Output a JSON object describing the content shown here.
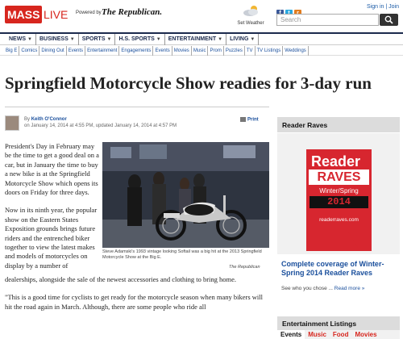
{
  "header": {
    "logo_primary": "MASS",
    "logo_secondary": "LIVE",
    "powered_by": "Powered by",
    "paper_name": "The Republican.",
    "weather_label": "Set Weather",
    "signin": "Sign in | Join",
    "search_placeholder": "Search"
  },
  "nav_primary": [
    {
      "label": "NEWS"
    },
    {
      "label": "BUSINESS"
    },
    {
      "label": "SPORTS"
    },
    {
      "label": "H.S. SPORTS"
    },
    {
      "label": "ENTERTAINMENT"
    },
    {
      "label": "LIVING"
    }
  ],
  "nav_caret": "▼",
  "nav_secondary": [
    "Big E",
    "Comics",
    "Dining Out",
    "Events",
    "Entertainment",
    "Engagements",
    "Events",
    "Movies",
    "Music",
    "Prom",
    "Puzzles",
    "TV",
    "TV Listings",
    "Weddings"
  ],
  "article": {
    "headline": "Springfield Motorcycle Show readies for 3-day run",
    "byline_prefix": "By",
    "author": "Keith O'Connor",
    "dateline": "on January 14, 2014 at 4:55 PM, updated January 14, 2014 at 4:57 PM",
    "print_label": "Print",
    "lead_paragraphs": [
      "President's Day in February may be the time to get a good deal on a car, but in January the time to buy a new bike is at the Springfield Motorcycle Show which opens its doors on Friday for three days.",
      "Now in its ninth year, the popular show on the Eastern States Exposition grounds brings future riders and the entrenched biker together to view the latest makes and models of motorcycles on display by a number of"
    ],
    "wide_paragraphs": [
      "dealerships, alongside the sale of the newest accessories and clothing to bring home.",
      "\"This is a good time for cyclists to get ready for the motorcycle season when many bikers will hit the road again in March. Although, there are some people who ride all"
    ],
    "photo_caption": "Steve Adamski's 1993 vintage looking Softail was a big hit at the 2013 Springfield Motorcycle Show at the Big E.",
    "photo_credit": "The Republican"
  },
  "sidebar": {
    "reader_raves_title": "Reader Raves",
    "ad": {
      "reader": "Reader",
      "raves": "RAVES",
      "season": "Winter/Spring",
      "year": "2014",
      "site": "readerraves.com"
    },
    "link_text": "Complete coverage of Winter-Spring 2014 Reader Raves",
    "more_prefix": "See who you chose ...",
    "more_link": "Read more »",
    "listings_title": "Entertainment Listings",
    "listings_tabs": [
      "Events",
      "Music",
      "Food",
      "Movies"
    ]
  },
  "colors": {
    "brand_red": "#d7261e",
    "nav_blue": "#1c2a4d",
    "link_blue": "#1a4f9c"
  }
}
